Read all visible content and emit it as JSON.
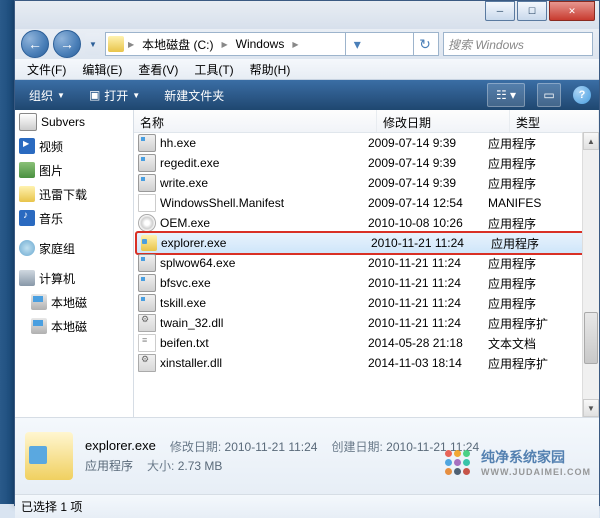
{
  "path": {
    "seg1": "本地磁盘 (C:)",
    "seg2": "Windows"
  },
  "search_placeholder": "搜索 Windows",
  "menu": {
    "file": "文件(F)",
    "edit": "编辑(E)",
    "view": "查看(V)",
    "tools": "工具(T)",
    "help": "帮助(H)"
  },
  "toolbar": {
    "organize": "组织",
    "open": "打开",
    "newfolder": "新建文件夹"
  },
  "tree": {
    "svn": "Subvers",
    "video": "视频",
    "pic": "图片",
    "thunder": "迅雷下载",
    "music": "音乐",
    "homegroup": "家庭组",
    "computer": "计算机",
    "disk": "本地磁"
  },
  "cols": {
    "name": "名称",
    "date": "修改日期",
    "type": "类型"
  },
  "rows": [
    {
      "icon": "i-exe",
      "name": "hh.exe",
      "date": "2009-07-14 9:39",
      "type": "应用程序"
    },
    {
      "icon": "i-exe",
      "name": "regedit.exe",
      "date": "2009-07-14 9:39",
      "type": "应用程序"
    },
    {
      "icon": "i-exe",
      "name": "write.exe",
      "date": "2009-07-14 9:39",
      "type": "应用程序"
    },
    {
      "icon": "i-manifest",
      "name": "WindowsShell.Manifest",
      "date": "2009-07-14 12:54",
      "type": "MANIFES"
    },
    {
      "icon": "i-cd",
      "name": "OEM.exe",
      "date": "2010-10-08 10:26",
      "type": "应用程序"
    },
    {
      "icon": "i-explorer2",
      "name": "explorer.exe",
      "date": "2010-11-21 11:24",
      "type": "应用程序",
      "sel": true,
      "hl": true
    },
    {
      "icon": "i-exe",
      "name": "splwow64.exe",
      "date": "2010-11-21 11:24",
      "type": "应用程序"
    },
    {
      "icon": "i-exe",
      "name": "bfsvc.exe",
      "date": "2010-11-21 11:24",
      "type": "应用程序"
    },
    {
      "icon": "i-exe",
      "name": "tskill.exe",
      "date": "2010-11-21 11:24",
      "type": "应用程序"
    },
    {
      "icon": "i-dll",
      "name": "twain_32.dll",
      "date": "2010-11-21 11:24",
      "type": "应用程序扩"
    },
    {
      "icon": "i-txt",
      "name": "beifen.txt",
      "date": "2014-05-28 21:18",
      "type": "文本文档"
    },
    {
      "icon": "i-dll",
      "name": "xinstaller.dll",
      "date": "2014-11-03 18:14",
      "type": "应用程序扩"
    }
  ],
  "details": {
    "name": "explorer.exe",
    "date_l": "修改日期:",
    "date_v": "2010-11-21 11:24",
    "cdate_l": "创建日期:",
    "cdate_v": "2010-11-21 11:24",
    "type": "应用程序",
    "size_l": "大小:",
    "size_v": "2.73 MB"
  },
  "status": "已选择 1 项",
  "watermark": "纯净系统家园",
  "watermark_url": "WWW.JUDAIMEI.COM"
}
